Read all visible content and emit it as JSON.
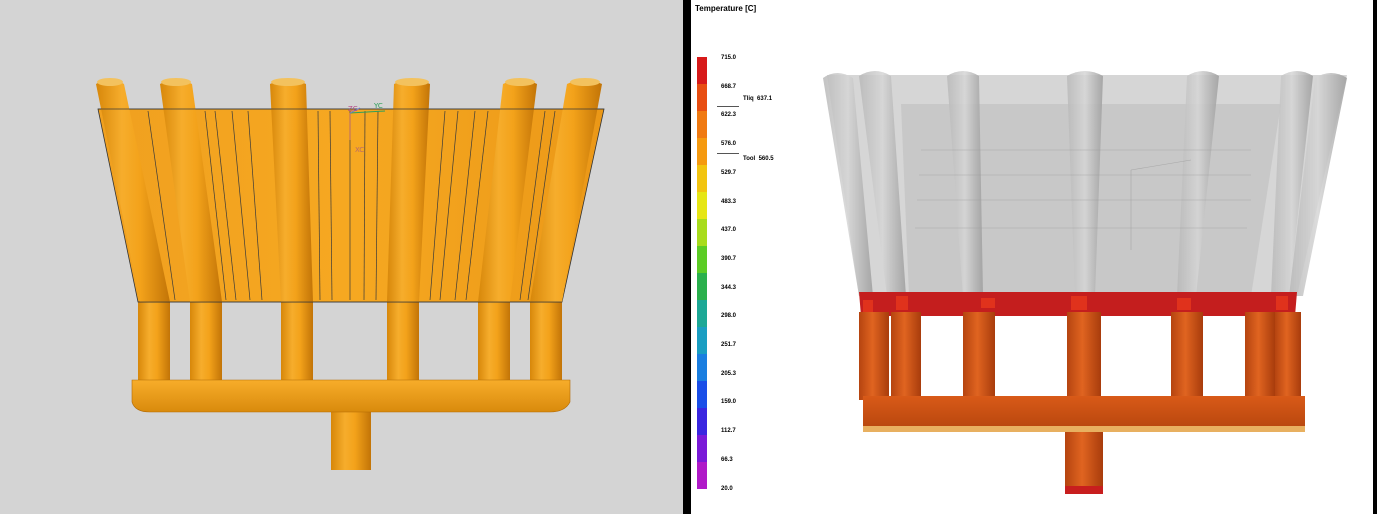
{
  "left_view": {
    "axes": {
      "xc": "XC",
      "yc": "YC",
      "zc": "ZC"
    }
  },
  "right_view": {
    "legend": {
      "title": "Temperature  [C]",
      "ticks": [
        "715.0",
        "668.7",
        "622.3",
        "576.0",
        "529.7",
        "483.3",
        "437.0",
        "390.7",
        "344.3",
        "298.0",
        "251.7",
        "205.3",
        "159.0",
        "112.7",
        "66.3",
        "20.0"
      ],
      "liquidus_label": "Tliq",
      "liquidus_value": "637.1",
      "tool_label": "Tool",
      "tool_value": "560.5",
      "colors": [
        "#d71a1a",
        "#e84e12",
        "#f07a12",
        "#f59a10",
        "#f2c410",
        "#e6e615",
        "#a8dc1c",
        "#5ccc25",
        "#2ab04d",
        "#1ca896",
        "#1a9ec2",
        "#1a7ee0",
        "#1a4ee8",
        "#3a26e0",
        "#7a1ad8",
        "#b01ac8"
      ]
    }
  }
}
